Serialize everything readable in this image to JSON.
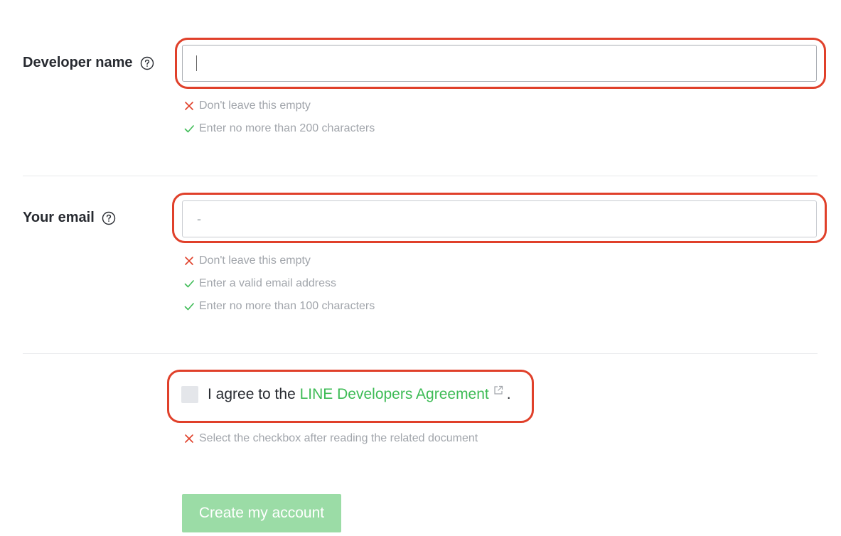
{
  "developer_name": {
    "label": "Developer name",
    "value": "",
    "help_icon": "question-circle-icon",
    "rules": [
      {
        "status": "error",
        "icon": "x-icon",
        "text": "Don't leave this empty"
      },
      {
        "status": "ok",
        "icon": "check-icon",
        "text": "Enter no more than 200 characters"
      }
    ]
  },
  "email": {
    "label": "Your email",
    "value": "-",
    "help_icon": "question-circle-icon",
    "rules": [
      {
        "status": "error",
        "icon": "x-icon",
        "text": "Don't leave this empty"
      },
      {
        "status": "ok",
        "icon": "check-icon",
        "text": "Enter a valid email address"
      },
      {
        "status": "ok",
        "icon": "check-icon",
        "text": "Enter no more than 100 characters"
      }
    ]
  },
  "agreement": {
    "prefix": "I agree to the",
    "link_text": "LINE Developers Agreement",
    "suffix": ".",
    "link_icon": "external-link-icon",
    "checked": false,
    "rule": {
      "status": "error",
      "icon": "x-icon",
      "text": "Select the checkbox after reading the related document"
    }
  },
  "submit": {
    "label": "Create my account"
  },
  "colors": {
    "error": "#e0402a",
    "ok": "#3dbb55",
    "highlight": "#e0402a",
    "button_disabled": "#9bdca6",
    "link": "#3dbb55"
  }
}
